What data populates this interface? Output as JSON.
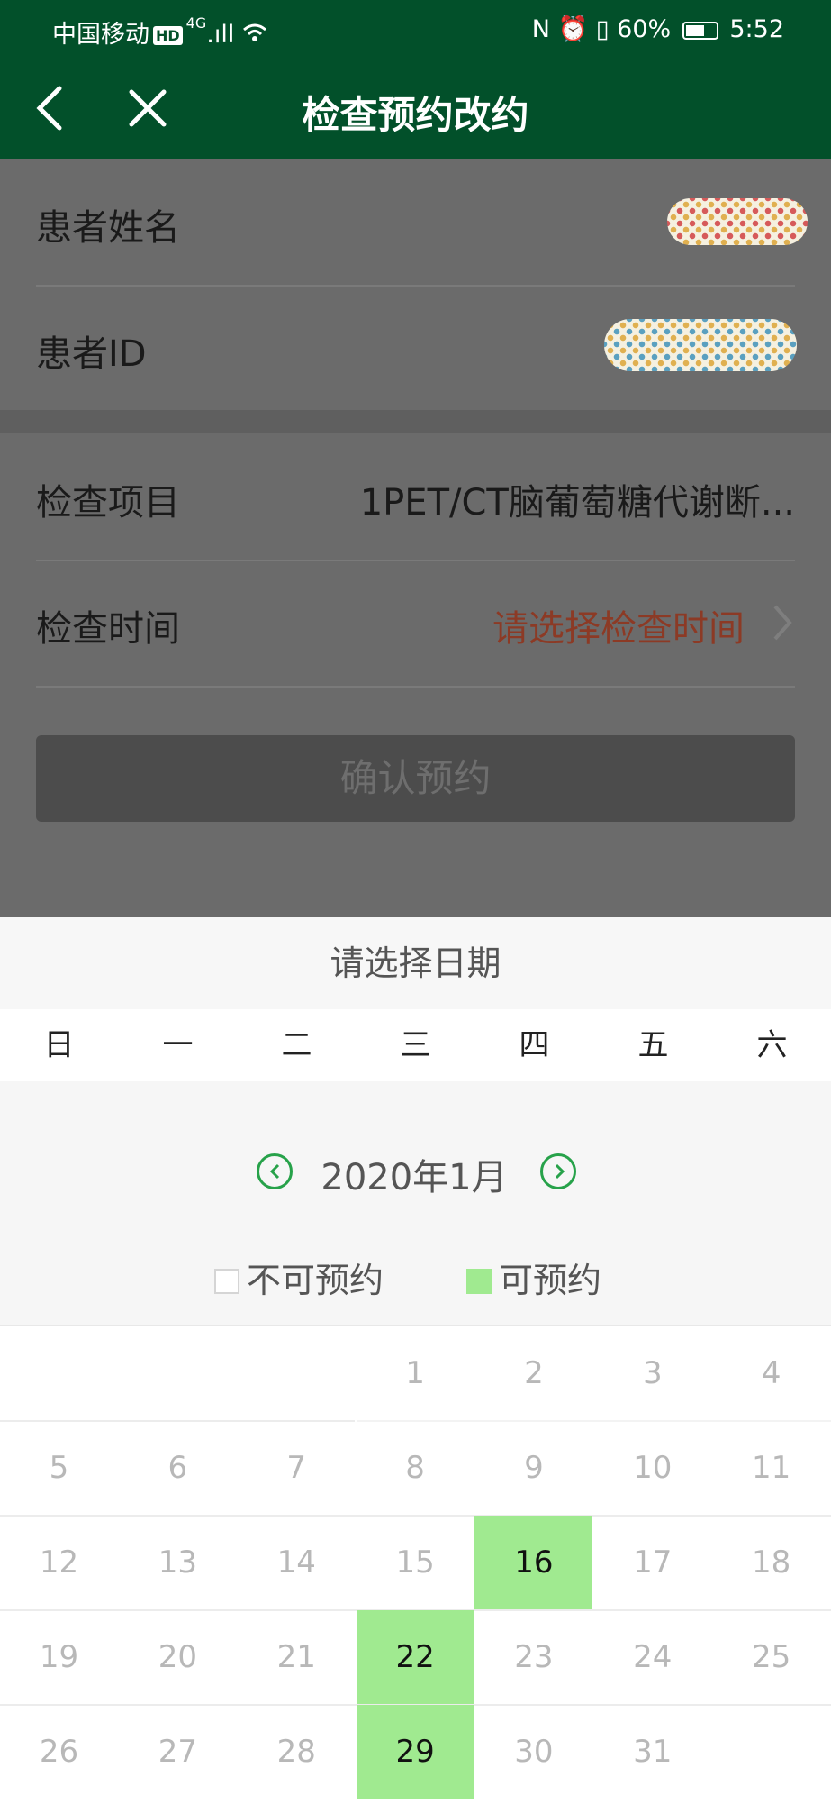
{
  "status_bar": {
    "carrier": "中国移动",
    "hd": "HD",
    "network": "4G",
    "battery": "60%",
    "time": "5:52"
  },
  "header": {
    "title": "检查预约改约"
  },
  "form": {
    "patient_name_label": "患者姓名",
    "patient_id_label": "患者ID",
    "exam_item_label": "检查项目",
    "exam_item_value": "1PET/CT脑葡萄糖代谢断...",
    "exam_time_label": "检查时间",
    "exam_time_placeholder": "请选择检查时间",
    "confirm_button": "确认预约"
  },
  "date_picker": {
    "title": "请选择日期",
    "weekdays": [
      "日",
      "一",
      "二",
      "三",
      "四",
      "五",
      "六"
    ],
    "month_label": "2020年1月",
    "legend": {
      "unavailable": "不可预约",
      "available": "可预约"
    },
    "first_weekday_index": 3,
    "days": [
      "1",
      "2",
      "3",
      "4",
      "5",
      "6",
      "7",
      "8",
      "9",
      "10",
      "11",
      "12",
      "13",
      "14",
      "15",
      "16",
      "17",
      "18",
      "19",
      "20",
      "21",
      "22",
      "23",
      "24",
      "25",
      "26",
      "27",
      "28",
      "29",
      "30",
      "31"
    ],
    "available_days": [
      "16",
      "22",
      "29"
    ]
  },
  "colors": {
    "header_bg": "#02502a",
    "accent_green": "#27a24a",
    "available_bg": "#a0ea90",
    "placeholder_red": "#8c3a25"
  }
}
